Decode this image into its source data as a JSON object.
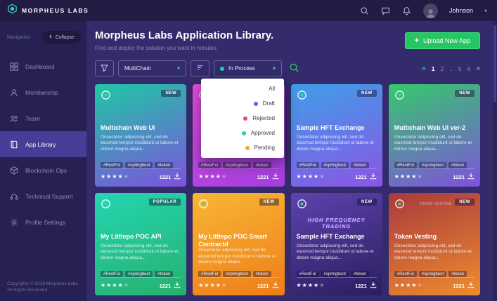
{
  "topbar": {
    "brand": "MORPHEUS LABS",
    "user": "Johnson"
  },
  "sidebar": {
    "section_label": "Navigation",
    "collapse_label": "Collapse",
    "items": [
      {
        "label": "Dashboard"
      },
      {
        "label": "Membership"
      },
      {
        "label": "Team"
      },
      {
        "label": "App Library"
      },
      {
        "label": "Blockchain Ops"
      },
      {
        "label": "Technical Support"
      },
      {
        "label": "Profile Settings"
      }
    ],
    "footer_line1": "Copyrights © 2018 Morpheus Labs.",
    "footer_line2": "All Rights Reserved."
  },
  "header": {
    "title": "Morpheus Labs Application Library.",
    "subtitle": "Find and deploy the solution you want in minutes",
    "upload_label": "Upload New App"
  },
  "filters": {
    "chain_select": "MultiChain",
    "status_select": "In Process",
    "status_dot": "#1fd1b0",
    "menu_items": [
      {
        "label": "All",
        "dot": ""
      },
      {
        "label": "Draft",
        "dot": "#7c4dff"
      },
      {
        "label": "Rejected",
        "dot": "#f1427c"
      },
      {
        "label": "Approved",
        "dot": "#1fd1b0"
      },
      {
        "label": "Pending",
        "dot": "#f5a623"
      }
    ]
  },
  "pagination": {
    "prev": "«",
    "pages": [
      "1",
      "2",
      "..",
      "5",
      "6"
    ],
    "next": "»"
  },
  "icons": {
    "plus": "+",
    "chevron_down": "▾",
    "star": "★"
  },
  "colors": {
    "accent_green": "#26c665",
    "teal": "#1fd1b0"
  },
  "cards": [
    {
      "title": "Multichain Web UI",
      "badge": "NEW",
      "description": "Onsectetur adipiscing elit, sed do eiusmod tempor incididunt ut labore et dolore magna aliqua...",
      "tags": [
        "#RestFul",
        "#springboot",
        "#token"
      ],
      "rating": 4,
      "downloads": "1221",
      "gradient_from": "#1ec8a5",
      "gradient_to": "#7e52dd",
      "art_text": ""
    },
    {
      "title": "",
      "badge": "NEW",
      "description": "",
      "tags": [
        "#RestFul",
        "#springboot",
        "#token"
      ],
      "rating": 4,
      "downloads": "1221",
      "gradient_from": "#ec4fd8",
      "gradient_to": "#a03ee0",
      "art_text": ""
    },
    {
      "title": "Sample HFT Exchange",
      "badge": "NEW",
      "description": "Onsectetur adipiscing elit, sed do eiusmod tempor incididunt ut labore et dolore magna aliqua...",
      "tags": [
        "#RestFul",
        "#springboot",
        "#token"
      ],
      "rating": 4,
      "downloads": "1221",
      "gradient_from": "#3f9fe8",
      "gradient_to": "#8a55e6",
      "art_text": ""
    },
    {
      "title": "Multichain Web UI ver-2",
      "badge": "NEW",
      "description": "Onsectetur adipiscing elit, sed do eiusmod tempor incididunt ut labore et dolore magna aliqua...",
      "tags": [
        "#RestFul",
        "#springboot",
        "#token"
      ],
      "rating": 4,
      "downloads": "1221",
      "gradient_from": "#35c96b",
      "gradient_to": "#7e52dd",
      "art_text": ""
    },
    {
      "title": "My Littlepo POC API",
      "badge": "POPULAR",
      "description": "Onsectetur adipiscing elit, sed do eiusmod tempor incididunt ut labore et dolore magna aliqua...",
      "tags": [
        "#RestFul",
        "#springboot",
        "#token"
      ],
      "rating": 4,
      "downloads": "1221",
      "gradient_from": "#23d6b2",
      "gradient_to": "#27b06e",
      "art_text": ""
    },
    {
      "title": "My Littlepo POC Smart Contractd",
      "badge": "NEW",
      "description": "Onsectetur adipiscing elit, sed do eiusmod tempor incididunt ut labore et dolore magna aliqua...",
      "tags": [
        "#RestFul",
        "#springboot",
        "#token"
      ],
      "rating": 4,
      "downloads": "1221",
      "gradient_from": "#f7b733",
      "gradient_to": "#ef7d1a",
      "art_text": ""
    },
    {
      "title": "Sample HFT Exchange",
      "badge": "NEW",
      "description": "Onsectetur adipiscing elit, sed do eiusmod tempor incididunt ut labore et dolore magna aliqua...",
      "tags": [
        "#RestFul",
        "#springboot",
        "#token"
      ],
      "rating": 4,
      "downloads": "1221",
      "gradient_from": "#5e42ad",
      "gradient_to": "#2a1e60",
      "art_text": "HIGH FREQUENCY TRADING"
    },
    {
      "title": "Token Vesting",
      "badge": "NEW",
      "description": "Onsectetur adipiscing elit, sed do eiusmod tempor incididunt ut labore et dolore magna aliqua...",
      "tags": [
        "#RestFul",
        "#springboot",
        "#token"
      ],
      "rating": 4,
      "downloads": "1221",
      "gradient_from": "#a93a3e",
      "gradient_to": "#ef8b2e",
      "art_text": "TOKEN VESTING"
    }
  ]
}
